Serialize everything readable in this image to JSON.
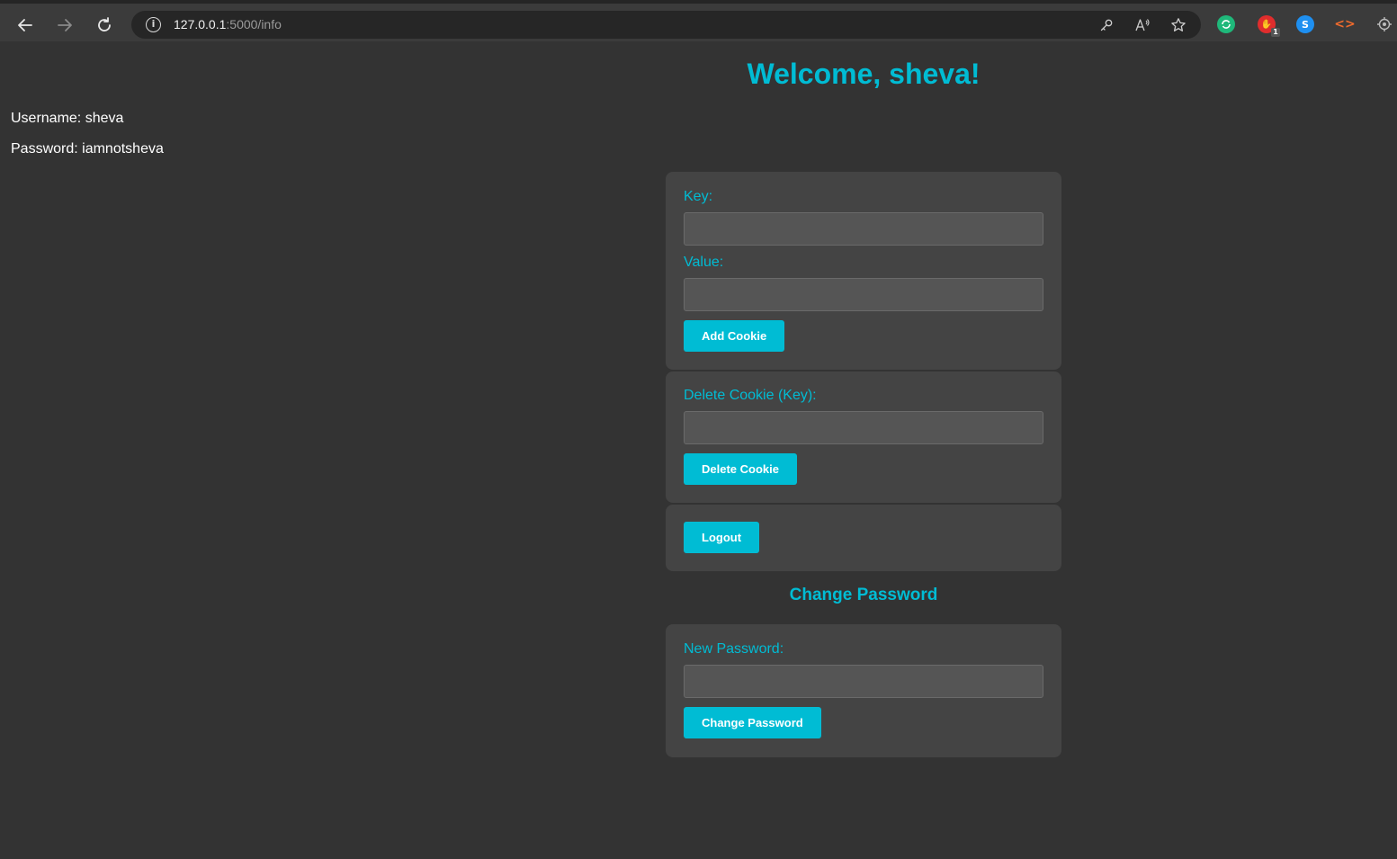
{
  "browser": {
    "url_host": "127.0.0.1",
    "url_path": ":5000/info",
    "back_icon": "arrow-left-icon",
    "forward_icon": "arrow-right-icon",
    "reload_icon": "reload-icon"
  },
  "page": {
    "welcome": "Welcome, sheva!",
    "username_line": "Username: sheva",
    "password_line": "Password: iamnotsheva",
    "cookie_form": {
      "key_label": "Key:",
      "value_label": "Value:",
      "add_button": "Add Cookie"
    },
    "delete_form": {
      "key_label": "Delete Cookie (Key):",
      "delete_button": "Delete Cookie"
    },
    "logout_button": "Logout",
    "change_password_title": "Change Password",
    "password_form": {
      "new_password_label": "New Password:",
      "submit_button": "Change Password"
    }
  },
  "colors": {
    "accent": "#00bcd4",
    "background": "#333333",
    "card": "#444444",
    "input": "#555555"
  }
}
